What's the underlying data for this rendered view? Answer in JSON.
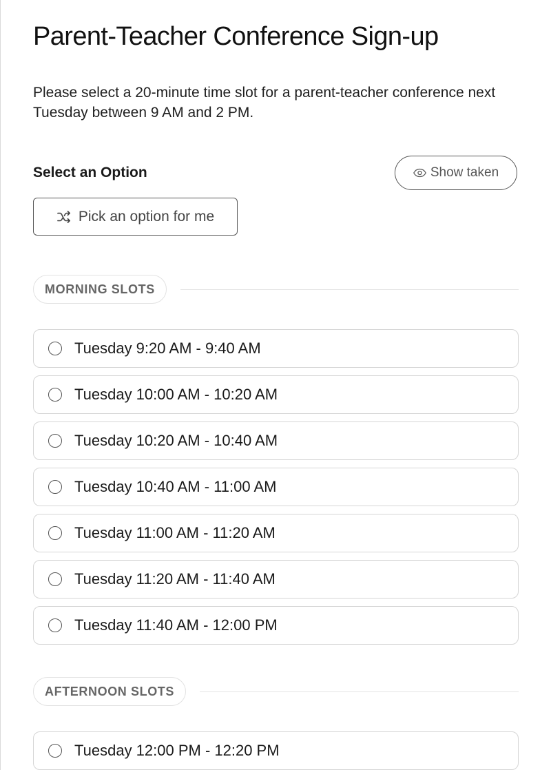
{
  "page": {
    "title": "Parent-Teacher Conference Sign-up",
    "description": "Please select a 20-minute time slot for a parent-teacher conference next Tuesday between 9 AM and 2 PM.",
    "select_heading": "Select an Option"
  },
  "actions": {
    "show_taken_label": "Show taken",
    "show_taken_icon": "eye-icon",
    "pick_label": "Pick an option for me",
    "pick_icon": "shuffle-icon"
  },
  "sections": {
    "morning": {
      "label": "MORNING SLOTS",
      "slots": [
        "Tuesday 9:20 AM - 9:40 AM",
        "Tuesday 10:00 AM - 10:20 AM",
        "Tuesday 10:20 AM - 10:40 AM",
        "Tuesday 10:40 AM - 11:00 AM",
        "Tuesday 11:00 AM - 11:20 AM",
        "Tuesday 11:20 AM - 11:40 AM",
        "Tuesday 11:40 AM - 12:00 PM"
      ]
    },
    "afternoon": {
      "label": "AFTERNOON SLOTS",
      "slots": [
        "Tuesday 12:00 PM - 12:20 PM"
      ]
    }
  },
  "colors": {
    "text": "#1a1a1a",
    "muted": "#666666",
    "border": "#d5d5d5",
    "button_border": "#555555"
  }
}
